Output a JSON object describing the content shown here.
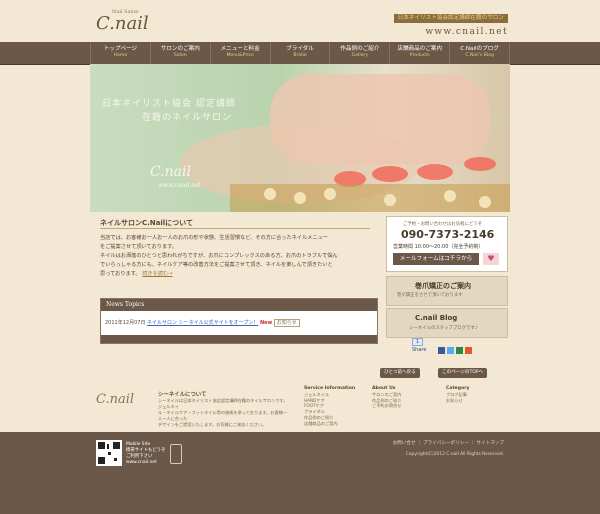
{
  "header": {
    "logo_small": "Nail Salon",
    "logo_big": "C.nail",
    "tagline": "日本ネイリスト協会認定講師在籍のサロン",
    "domain": "www.cnail.net"
  },
  "nav": [
    {
      "jp": "トップページ",
      "en": "Home"
    },
    {
      "jp": "サロンのご案内",
      "en": "Salon"
    },
    {
      "jp": "メニューと料金",
      "en": "Menu&Price"
    },
    {
      "jp": "ブライダル",
      "en": "Bridal"
    },
    {
      "jp": "作品例のご紹介",
      "en": "Gallery"
    },
    {
      "jp": "店舗商品のご案内",
      "en": "Products"
    },
    {
      "jp": "C.Nailのブログ",
      "en": "C.Nail's Blog"
    }
  ],
  "hero": {
    "line1": "日本ネイリスト協会 認定講師",
    "line2": "在籍のネイルサロン",
    "logo": "C.nail",
    "domain": "www.cnail.net"
  },
  "about": {
    "title": "ネイルサロンC.Nailについて",
    "lines": [
      "当店では、お客様お一人お一人のお爪の形や状態、生活習慣など、その方に合ったネイルメニュー",
      "をご提案させて頂いております。",
      "ネイルはお洒落のひとつと思われがちですが、お爪にコンプレックスのある方、お爪のトラブルで悩ん",
      "でいらっしゃる方にも、ネイルケア等の改善方法をご提案させて頂き、ネイルを楽しんで頂きたいと",
      "思っております。"
    ],
    "more": "続きを読む→"
  },
  "news": {
    "title": "News Topics",
    "date": "2011年12月07日",
    "link": "ネイルサロン シーネイル公式サイトをオープン！",
    "new_badge": "New",
    "tag": "お知らせ"
  },
  "side": {
    "tel_caption": "ご予約・お問い合わせはお気軽にどうぞ",
    "tel": "090-7373-2146",
    "hours": "営業時間 10:00～20:00（完全予約制）",
    "mail_btn": "メールフォームはコチラから",
    "info_title": "巻爪矯正のご案内",
    "info_sub": "巻爪矯正をさせて頂いております",
    "blog_title": "C.nail Blog",
    "blog_sub": "シーネイルのスタッフブログです♪",
    "share": "Share",
    "share_count": "1"
  },
  "bottom_buttons": {
    "back": "ひとつ前へ戻る",
    "top": "このページのTOPへ"
  },
  "footer": {
    "logo": "C.nail",
    "about_h": "シーネイルについて",
    "about_t": [
      "シーネイルは日本ネイリスト協会認定講師在籍のネイルサロンです。ジェルネイ",
      "ル・ネイルケア・フットネイル等の施術を承っております。お客様一人一人に合った",
      "デザインをご提案いたします。お気軽にご来店ください。"
    ],
    "service_h": "Service Information",
    "service": [
      "ジェルネイル",
      "HANDケア",
      "FOOTケア",
      "ブライダル",
      "作品例のご紹介",
      "店舗商品のご案内"
    ],
    "aboutus_h": "About Us",
    "aboutus": [
      "サロンのご案内",
      "作品例のご紹介",
      "ご予約お問合せ"
    ],
    "cat_h": "Category",
    "cat": [
      "ブログ記事",
      "お知らせ"
    ]
  },
  "footdark": {
    "mobile_h": "Mobile Site",
    "mobile_t": [
      "携帯サイトもどうぞ",
      "ご利用下さい",
      "www.cnail.net"
    ],
    "links": "お問い合せ ｜ プライバシーポリシー ｜ サイトマップ",
    "copyright": "Copyright(C)2012 C.nail All Rights Reserved."
  }
}
